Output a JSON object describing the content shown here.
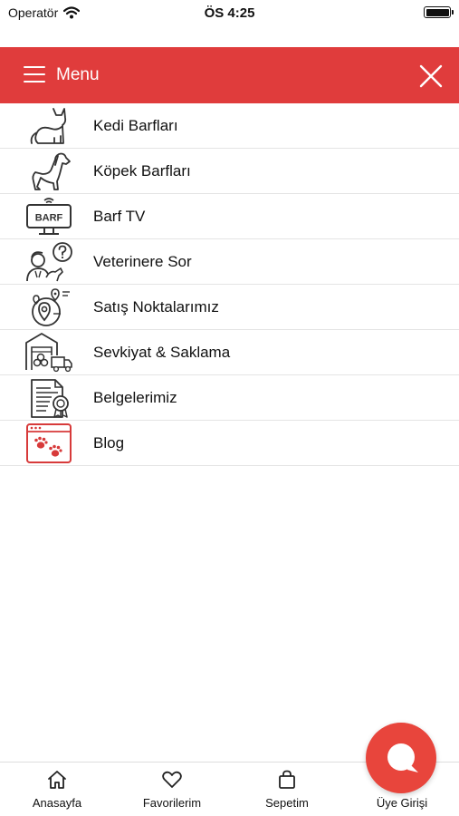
{
  "status_bar": {
    "carrier": "Operatör",
    "time": "ÖS 4:25"
  },
  "header": {
    "title": "Menu",
    "color": "#e03c3c"
  },
  "menu": {
    "items": [
      {
        "label": "Kedi Barfları",
        "icon": "cat-icon"
      },
      {
        "label": "Köpek Barfları",
        "icon": "dog-icon"
      },
      {
        "label": "Barf TV",
        "icon": "barf-tv-icon",
        "icon_text": "BARF"
      },
      {
        "label": "Veterinere Sor",
        "icon": "vet-question-icon"
      },
      {
        "label": "Satış Noktalarımız",
        "icon": "location-pin-icon"
      },
      {
        "label": "Sevkiyat & Saklama",
        "icon": "warehouse-truck-icon"
      },
      {
        "label": "Belgelerimiz",
        "icon": "certificate-icon"
      },
      {
        "label": "Blog",
        "icon": "blog-paw-icon"
      }
    ]
  },
  "tabbar": {
    "tabs": [
      {
        "label": "Anasayfa",
        "icon": "home-icon"
      },
      {
        "label": "Favorilerim",
        "icon": "heart-icon"
      },
      {
        "label": "Sepetim",
        "icon": "bag-icon"
      },
      {
        "label": "Üye Girişi",
        "icon": "user-icon"
      }
    ]
  },
  "accent_color": "#e8453c"
}
